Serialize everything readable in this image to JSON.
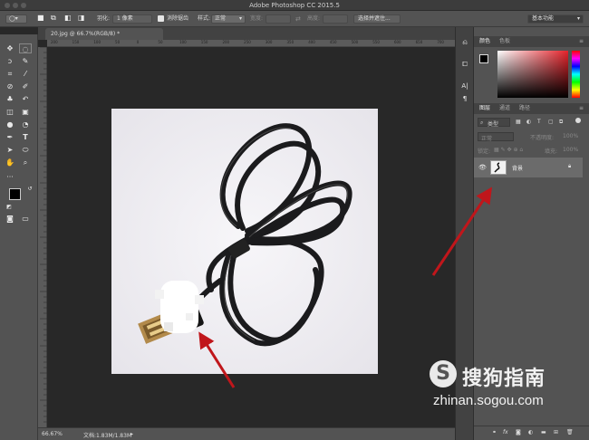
{
  "window": {
    "title": "Adobe Photoshop CC 2015.5"
  },
  "options_bar": {
    "feather_label": "羽化:",
    "feather_value": "1 像素",
    "antialias_label": "消除锯齿",
    "style_label": "样式:",
    "style_value": "正常",
    "width_label": "宽度:",
    "height_label": "高度:",
    "select_mask_button": "选择并遮住...",
    "workspace_value": "基本功能"
  },
  "document": {
    "tab_label": "20.jpg @ 66.7%(RGB/8) *",
    "zoom": "66.67%",
    "doc_size": "文档:1.83M/1.83M"
  },
  "rulers": {
    "h_ticks": [
      "200",
      "150",
      "100",
      "50",
      "0",
      "50",
      "100",
      "150",
      "200",
      "250",
      "300",
      "350",
      "400",
      "450",
      "500",
      "550",
      "600",
      "650",
      "700"
    ]
  },
  "color_panel": {
    "tabs": [
      "颜色",
      "色板"
    ]
  },
  "layers_panel": {
    "tabs": [
      "图层",
      "通道",
      "路径"
    ],
    "filter_label": "类型",
    "blend_mode": "正常",
    "opacity_label": "不透明度:",
    "opacity_value": "100%",
    "lock_label": "锁定:",
    "fill_label": "填充:",
    "fill_value": "100%",
    "layers": [
      {
        "name": "背景",
        "locked": true,
        "visible": true
      }
    ],
    "bottom_icons": [
      "link-icon",
      "fx-icon",
      "mask-icon",
      "adjustment-icon",
      "folder-icon",
      "new-layer-icon",
      "trash-icon"
    ],
    "fx_label": "fx"
  },
  "watermark": {
    "brand": "搜狗指南",
    "url": "zhinan.sogou.com"
  },
  "colors": {
    "annotation_arrow": "#c0161b",
    "panel_bg": "#535353",
    "canvas_bg": "#282828"
  }
}
